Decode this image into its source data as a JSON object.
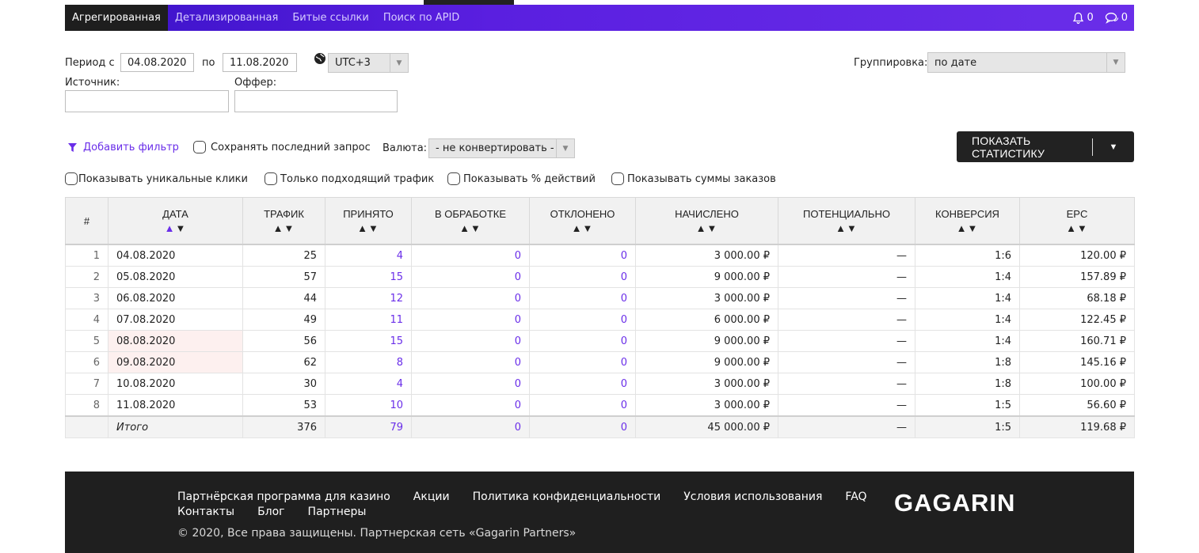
{
  "nav": {
    "tabs": [
      {
        "label": "Агрегированная",
        "active": true
      },
      {
        "label": "Детализированная",
        "active": false
      },
      {
        "label": "Битые ссылки",
        "active": false
      },
      {
        "label": "Поиск по APID",
        "active": false
      }
    ],
    "notifications_count": "0",
    "messages_count": "0",
    "colors": {
      "gradient_start": "#3a12c8",
      "gradient_end": "#6a2ee9",
      "active_tab": "#1e1e1e"
    }
  },
  "filters": {
    "period_from_label": "Период с",
    "period_from_value": "04.08.2020",
    "period_to_label": "по",
    "period_to_value": "11.08.2020",
    "timezone": "UTC+3",
    "grouping_label": "Группировка:",
    "grouping_value": "по дате",
    "source_label": "Источник:",
    "source_value": "",
    "offer_label": "Оффер:",
    "offer_value": "",
    "add_filter": "Добавить фильтр",
    "save_last_query": "Сохранять последний запрос",
    "currency_label": "Валюта:",
    "currency_value": "- не конвертировать -",
    "show_unique_clicks": "Показывать уникальные клики",
    "only_matching_traffic": "Только подходящий трафик",
    "show_percent_actions": "Показывать % действий",
    "show_order_sums": "Показывать суммы заказов"
  },
  "show_stats_button": "ПОКАЗАТЬ СТАТИСТИКУ",
  "table": {
    "headers": [
      "#",
      "ДАТА",
      "ТРАФИК",
      "ПРИНЯТО",
      "В ОБРАБОТКЕ",
      "ОТКЛОНЕНО",
      "НАЧИСЛЕНО",
      "ПОТЕНЦИАЛЬНО",
      "КОНВЕРСИЯ",
      "EPC"
    ],
    "rows": [
      {
        "idx": "1",
        "date": "04.08.2020",
        "traffic": "25",
        "accepted": "4",
        "processing": "0",
        "rejected": "0",
        "accrued": "3 000.00 ₽",
        "potential": "—",
        "conversion": "1:6",
        "epc": "120.00 ₽",
        "highlight": false
      },
      {
        "idx": "2",
        "date": "05.08.2020",
        "traffic": "57",
        "accepted": "15",
        "processing": "0",
        "rejected": "0",
        "accrued": "9 000.00 ₽",
        "potential": "—",
        "conversion": "1:4",
        "epc": "157.89 ₽",
        "highlight": false
      },
      {
        "idx": "3",
        "date": "06.08.2020",
        "traffic": "44",
        "accepted": "12",
        "processing": "0",
        "rejected": "0",
        "accrued": "3 000.00 ₽",
        "potential": "—",
        "conversion": "1:4",
        "epc": "68.18 ₽",
        "highlight": false
      },
      {
        "idx": "4",
        "date": "07.08.2020",
        "traffic": "49",
        "accepted": "11",
        "processing": "0",
        "rejected": "0",
        "accrued": "6 000.00 ₽",
        "potential": "—",
        "conversion": "1:4",
        "epc": "122.45 ₽",
        "highlight": false
      },
      {
        "idx": "5",
        "date": "08.08.2020",
        "traffic": "56",
        "accepted": "15",
        "processing": "0",
        "rejected": "0",
        "accrued": "9 000.00 ₽",
        "potential": "—",
        "conversion": "1:4",
        "epc": "160.71 ₽",
        "highlight": true
      },
      {
        "idx": "6",
        "date": "09.08.2020",
        "traffic": "62",
        "accepted": "8",
        "processing": "0",
        "rejected": "0",
        "accrued": "9 000.00 ₽",
        "potential": "—",
        "conversion": "1:8",
        "epc": "145.16 ₽",
        "highlight": true
      },
      {
        "idx": "7",
        "date": "10.08.2020",
        "traffic": "30",
        "accepted": "4",
        "processing": "0",
        "rejected": "0",
        "accrued": "3 000.00 ₽",
        "potential": "—",
        "conversion": "1:8",
        "epc": "100.00 ₽",
        "highlight": false
      },
      {
        "idx": "8",
        "date": "11.08.2020",
        "traffic": "53",
        "accepted": "10",
        "processing": "0",
        "rejected": "0",
        "accrued": "3 000.00 ₽",
        "potential": "—",
        "conversion": "1:5",
        "epc": "56.60 ₽",
        "highlight": false
      }
    ],
    "total": {
      "label": "Итого",
      "traffic": "376",
      "accepted": "79",
      "processing": "0",
      "rejected": "0",
      "accrued": "45 000.00 ₽",
      "potential": "—",
      "conversion": "1:5",
      "epc": "119.68 ₽"
    }
  },
  "footer": {
    "links_row1": [
      "Партнёрская программа для казино",
      "Акции",
      "Политика конфиденциальности",
      "Условия использования",
      "FAQ"
    ],
    "links_row2": [
      "Контакты",
      "Блог",
      "Партнеры"
    ],
    "copyright": "© 2020, Все права защищены. Партнерская сеть «Gagarin Partners»",
    "logo": "GAGARIN"
  },
  "accent_color": "#6a2ee9"
}
